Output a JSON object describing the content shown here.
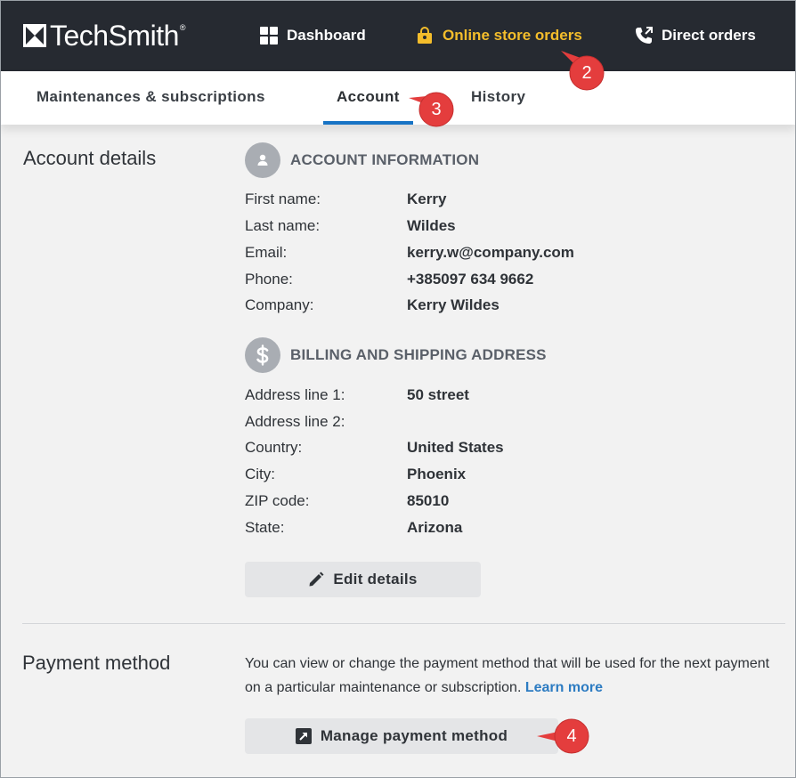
{
  "brand": {
    "name": "TechSmith",
    "reg": "®"
  },
  "topnav": {
    "dashboard": "Dashboard",
    "store_orders": "Online store orders",
    "direct_orders": "Direct orders",
    "active_color": "#f4bd2b"
  },
  "tabs": [
    {
      "label": "Maintenances & subscriptions"
    },
    {
      "label": "Account",
      "active": true
    },
    {
      "label": "History"
    }
  ],
  "account": {
    "section_title": "Account details",
    "info_heading": "ACCOUNT INFORMATION",
    "info_fields": [
      {
        "label": "First name:",
        "value": "Kerry"
      },
      {
        "label": "Last name:",
        "value": "Wildes"
      },
      {
        "label": "Email:",
        "value": "kerry.w@company.com"
      },
      {
        "label": "Phone:",
        "value": "+385097 634 9662"
      },
      {
        "label": "Company:",
        "value": "Kerry Wildes"
      }
    ],
    "billing_heading": "BILLING AND SHIPPING ADDRESS",
    "billing_fields": [
      {
        "label": "Address line 1:",
        "value": "50 street"
      },
      {
        "label": "Address line 2:",
        "value": ""
      },
      {
        "label": "Country:",
        "value": "United States"
      },
      {
        "label": "City:",
        "value": "Phoenix"
      },
      {
        "label": "ZIP code:",
        "value": "85010"
      },
      {
        "label": "State:",
        "value": "Arizona"
      }
    ],
    "edit_button": "Edit details"
  },
  "payment": {
    "section_title": "Payment method",
    "description": "You can view or change the payment method that will be used for the next payment on a particular maintenance or subscription.",
    "learn_more": "Learn more",
    "manage_button": "Manage payment method"
  },
  "callouts": [
    "2",
    "3",
    "4"
  ]
}
